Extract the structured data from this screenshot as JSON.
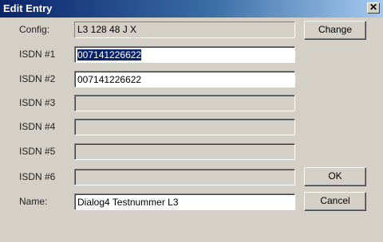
{
  "window": {
    "title": "Edit Entry",
    "close_glyph": "✕"
  },
  "form": {
    "config_label": "Config:",
    "config_value": "L3   128 48 J X",
    "isdn1_label": "ISDN #1",
    "isdn1_value": "007141226622",
    "isdn2_label": "ISDN #2",
    "isdn2_value": "007141226622",
    "isdn3_label": "ISDN #3",
    "isdn3_value": "",
    "isdn4_label": "ISDN #4",
    "isdn4_value": "",
    "isdn5_label": "ISDN #5",
    "isdn5_value": "",
    "isdn6_label": "ISDN #6",
    "isdn6_value": "",
    "name_label": "Name:",
    "name_value": "Dialog4 Testnummer L3"
  },
  "buttons": {
    "change": "Change",
    "ok": "OK",
    "cancel": "Cancel"
  },
  "colors": {
    "titlebar_start": "#0a246a",
    "titlebar_end": "#a6caf0",
    "dialog_bg": "#d4d0c8",
    "selection_bg": "#0a246a"
  }
}
